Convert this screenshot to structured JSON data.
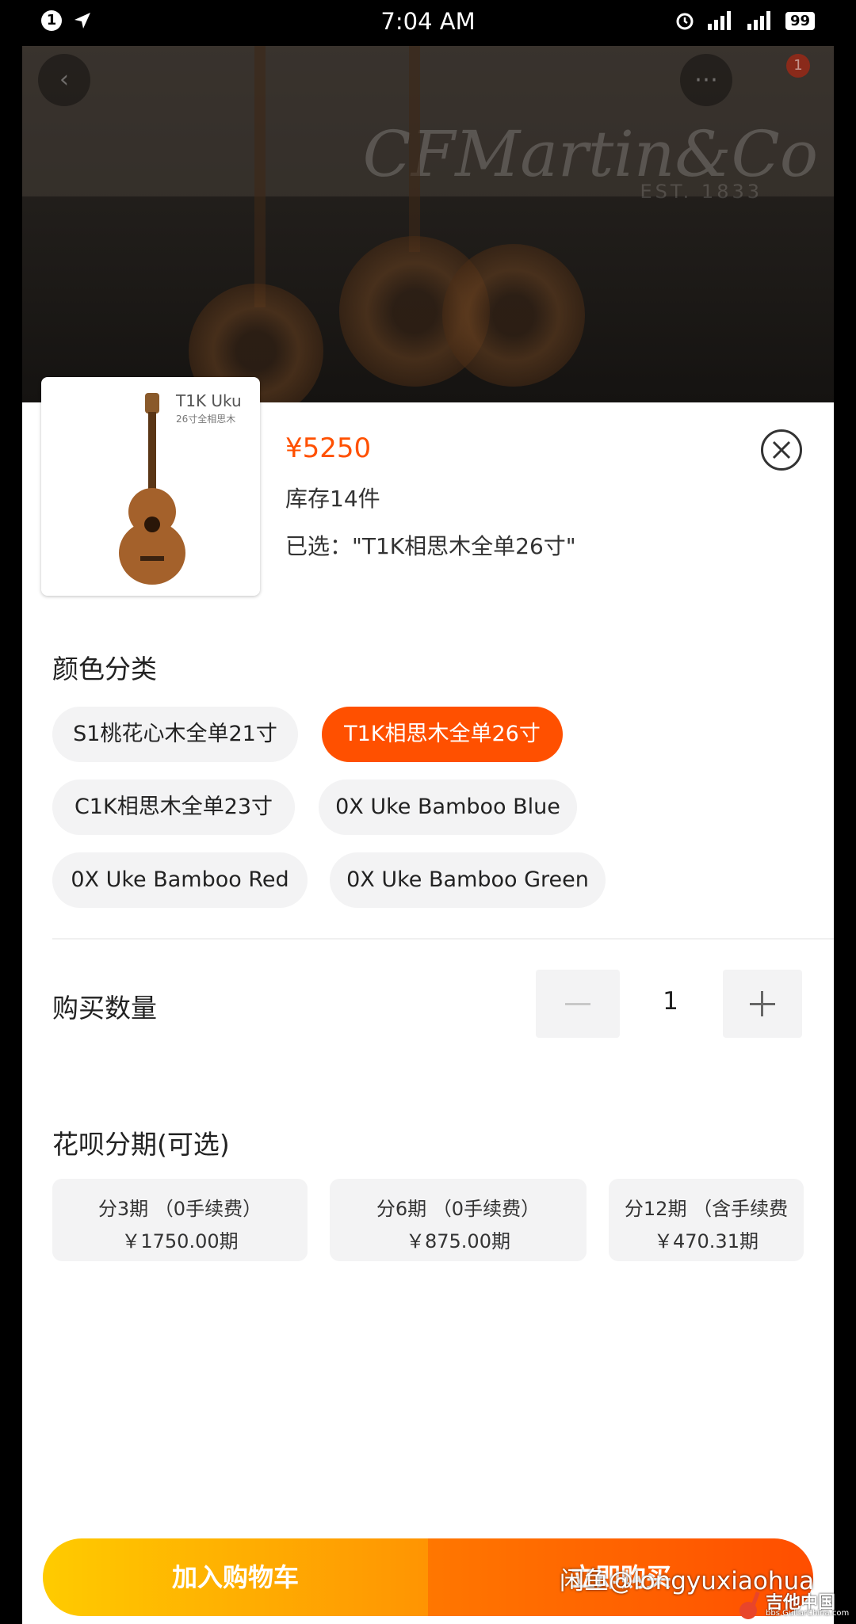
{
  "status_bar": {
    "time": "7:04 AM",
    "notification_count": "1",
    "battery": "99"
  },
  "backdrop": {
    "brand": "CFMartin&Co",
    "est": "EST. 1833",
    "cart_badge": "1"
  },
  "product": {
    "thumb_title": "T1K Uku",
    "thumb_subtitle": "26寸全相思木",
    "price": "¥5250",
    "stock": "库存14件",
    "selected": "已选：\"T1K相思木全单26寸\""
  },
  "color_section": {
    "title": "颜色分类",
    "options": [
      {
        "label": "S1桃花心木全单21寸",
        "active": false
      },
      {
        "label": "T1K相思木全单26寸",
        "active": true
      },
      {
        "label": "C1K相思木全单23寸",
        "active": false
      },
      {
        "label": "0X Uke Bamboo  Blue",
        "active": false
      },
      {
        "label": "0X Uke Bamboo  Red",
        "active": false
      },
      {
        "label": "0X Uke Bamboo  Green",
        "active": false
      }
    ]
  },
  "quantity_section": {
    "title": "购买数量",
    "value": "1"
  },
  "installment_section": {
    "title": "花呗分期(可选)",
    "options": [
      {
        "line1": "分3期 （0手续费）",
        "line2": "￥1750.00期"
      },
      {
        "line1": "分6期 （0手续费）",
        "line2": "￥875.00期"
      },
      {
        "line1": "分12期 （含手续费",
        "line2": "￥470.31期"
      }
    ]
  },
  "bottom": {
    "add_to_cart": "加入购物车",
    "buy_now": "立即购买"
  },
  "watermark": "闲鱼@longyuxiaohua",
  "corner_logo": {
    "name": "吉他中国",
    "url": "bbs.GuitarChina.com"
  },
  "colors": {
    "accent": "#ff5000",
    "cart_start": "#ffcb00",
    "cart_end": "#ff9402"
  }
}
